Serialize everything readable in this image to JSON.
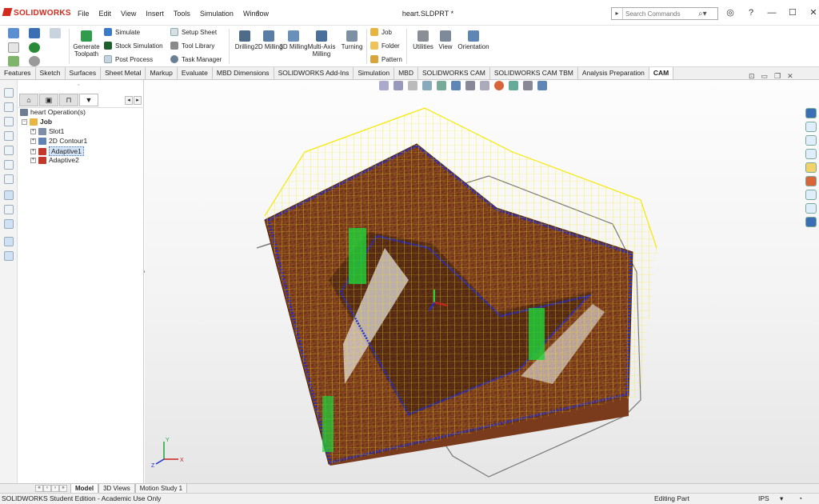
{
  "app": {
    "name": "SOLIDWORKS",
    "document_title": "heart.SLDPRT *"
  },
  "menu": [
    "File",
    "Edit",
    "View",
    "Insert",
    "Tools",
    "Simulation",
    "Window"
  ],
  "search": {
    "placeholder": "Search Commands"
  },
  "window_controls": [
    "help-icon",
    "user-icon",
    "minimize-icon",
    "maximize-icon",
    "close-icon"
  ],
  "ribbon": {
    "generate_toolpath": "Generate Toolpath",
    "simulate": "Simulate",
    "stock_simulation": "Stock Simulation",
    "post_process": "Post Process",
    "setup_sheet": "Setup Sheet",
    "tool_library": "Tool Library",
    "task_manager": "Task Manager",
    "drilling": "Drilling",
    "milling_2d": "2D Milling",
    "milling_3d": "3D Milling",
    "multi_axis": "Multi-Axis Milling",
    "turning": "Turning",
    "job": "Job",
    "folder": "Folder",
    "pattern": "Pattern",
    "utilities": "Utilities",
    "view": "View",
    "orientation": "Orientation"
  },
  "command_tabs": [
    {
      "label": "Features",
      "active": false
    },
    {
      "label": "Sketch",
      "active": false
    },
    {
      "label": "Surfaces",
      "active": false
    },
    {
      "label": "Sheet Metal",
      "active": false
    },
    {
      "label": "Markup",
      "active": false
    },
    {
      "label": "Evaluate",
      "active": false
    },
    {
      "label": "MBD Dimensions",
      "active": false
    },
    {
      "label": "SOLIDWORKS Add-Ins",
      "active": false
    },
    {
      "label": "Simulation",
      "active": false
    },
    {
      "label": "MBD",
      "active": false
    },
    {
      "label": "SOLIDWORKS CAM",
      "active": false
    },
    {
      "label": "SOLIDWORKS CAM TBM",
      "active": false
    },
    {
      "label": "Analysis Preparation",
      "active": false
    },
    {
      "label": "CAM",
      "active": true
    }
  ],
  "tree": {
    "root": "heart Operation(s)",
    "job": "Job",
    "items": [
      "Slot1",
      "2D Contour1",
      "Adaptive1",
      "Adaptive2"
    ],
    "selected": "Adaptive1"
  },
  "bottom_tabs": [
    {
      "label": "Model",
      "active": true
    },
    {
      "label": "3D Views",
      "active": false
    },
    {
      "label": "Motion Study 1",
      "active": false
    }
  ],
  "status": {
    "edition": "SOLIDWORKS Student Edition - Academic Use Only",
    "mode": "Editing Part",
    "units": "IPS"
  },
  "axes": {
    "x": "X",
    "y": "Y",
    "z": "Z"
  },
  "colors": {
    "toolpath": "#f5e800",
    "engage": "#1e2bd8",
    "plunge": "#1fd33a",
    "stock": "#7a3a1c"
  }
}
